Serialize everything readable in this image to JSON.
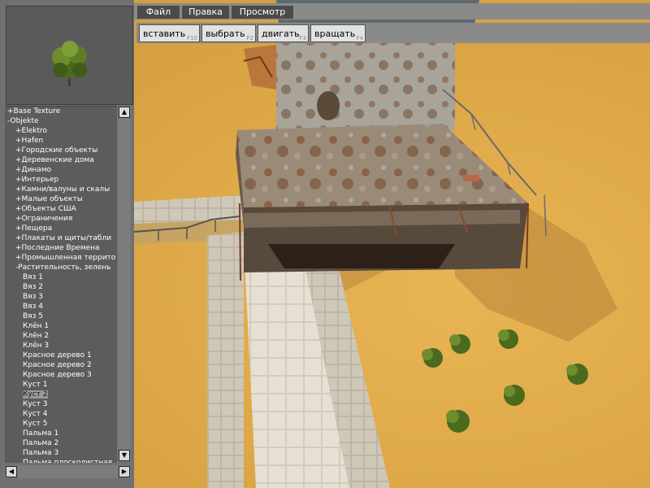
{
  "menu": [
    "Файл",
    "Правка",
    "Просмотр"
  ],
  "toolbar": [
    {
      "label": "вставить",
      "key": "F10"
    },
    {
      "label": "выбрать",
      "key": "F2"
    },
    {
      "label": "двигать",
      "key": "F3"
    },
    {
      "label": "вращать",
      "key": "F4"
    }
  ],
  "tree": [
    {
      "label": "+Base Texture",
      "depth": 0
    },
    {
      "label": "-Objekte",
      "depth": 0
    },
    {
      "label": "+Elektro",
      "depth": 1
    },
    {
      "label": "+Hafen",
      "depth": 1
    },
    {
      "label": "+Городские объекты",
      "depth": 1
    },
    {
      "label": "+Деревенские дома",
      "depth": 1
    },
    {
      "label": "+Динамо",
      "depth": 1
    },
    {
      "label": "+Интерьер",
      "depth": 1
    },
    {
      "label": "+Камни/валуны и скалы",
      "depth": 1
    },
    {
      "label": "+Малые объекты",
      "depth": 1
    },
    {
      "label": "+Объекты США",
      "depth": 1
    },
    {
      "label": "+Ограничения",
      "depth": 1
    },
    {
      "label": "+Пещера",
      "depth": 1
    },
    {
      "label": "+Плакаты и щиты/табли",
      "depth": 1
    },
    {
      "label": "+Последние Времена",
      "depth": 1
    },
    {
      "label": "+Промышленная террито",
      "depth": 1
    },
    {
      "label": "-Растительность, зелень",
      "depth": 1
    },
    {
      "label": "Вяз 1",
      "depth": 2
    },
    {
      "label": "Вяз 2",
      "depth": 2
    },
    {
      "label": "Вяз 3",
      "depth": 2
    },
    {
      "label": "Вяз 4",
      "depth": 2
    },
    {
      "label": "Вяз 5",
      "depth": 2
    },
    {
      "label": "Клён 1",
      "depth": 2
    },
    {
      "label": "Клён 2",
      "depth": 2
    },
    {
      "label": "Клён 3",
      "depth": 2
    },
    {
      "label": "Красное дерево 1",
      "depth": 2
    },
    {
      "label": "Красное дерево 2",
      "depth": 2
    },
    {
      "label": "Красное дерево 3",
      "depth": 2
    },
    {
      "label": "Куст 1",
      "depth": 2
    },
    {
      "label": "Куст 2",
      "depth": 2,
      "selected": true
    },
    {
      "label": "Куст 3",
      "depth": 2
    },
    {
      "label": "Куст 4",
      "depth": 2
    },
    {
      "label": "Куст 5",
      "depth": 2
    },
    {
      "label": "Пальма 1",
      "depth": 2
    },
    {
      "label": "Пальма 2",
      "depth": 2
    },
    {
      "label": "Пальма 3",
      "depth": 2
    },
    {
      "label": "Пальма плосколистная",
      "depth": 2
    }
  ],
  "scroll_icons": {
    "up": "arrow-up-icon",
    "down": "arrow-down-icon",
    "left": "arrow-left-icon",
    "right": "arrow-right-icon"
  },
  "colors": {
    "sand": "#dca646",
    "panel": "#707070",
    "tree_bg": "#5c5c5c",
    "menu_btn": "#4b4b4b",
    "tool_btn": "#e2e2e2"
  }
}
